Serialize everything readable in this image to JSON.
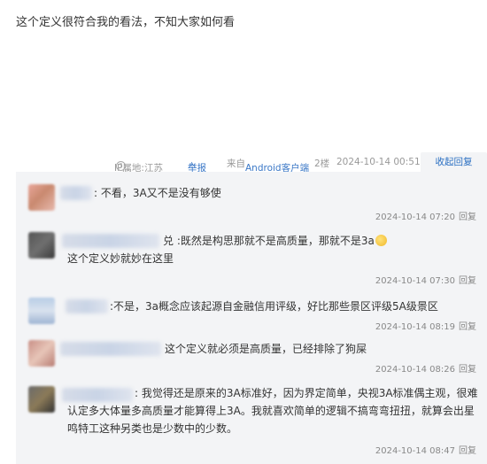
{
  "post": {
    "text": "这个定义很符合我的看法，不知大家如何看"
  },
  "meta": {
    "ip_location": "IP属地:江苏",
    "report_label": "举报",
    "source": "来自Android客户端",
    "floor": "2楼",
    "timestamp": "2024-10-14 00:51",
    "collapse_label": "收起回复"
  },
  "replies": [
    {
      "text": ": 不看，3A又不是没有够使",
      "time": "2024-10-14 07:20",
      "reply_label": "回复"
    },
    {
      "text_part1": "兑 :既然是构思那就不是高质量，那就不是3a",
      "text_part2": "这个定义妙就妙在这里",
      "time": "2024-10-14 07:30",
      "reply_label": "回复"
    },
    {
      "text": ":不是，3a概念应该起源自金融信用评级，好比那些景区评级5A级景区",
      "time": "2024-10-14 08:19",
      "reply_label": "回复"
    },
    {
      "text": "这个定义就必须是高质量，已经排除了狗屎",
      "time": "2024-10-14 08:26",
      "reply_label": "回复"
    },
    {
      "text": ": 我觉得还是原来的3A标准好，因为界定简单，央视3A标准偶主观，很难认定多大体量多高质量才能算得上3A。我就喜欢简单的逻辑不搞弯弯扭扭，就算会出星鸣特工这种另类也是少数中的少数。",
      "time": "2024-10-14 08:47",
      "reply_label": "回复"
    }
  ],
  "colors": {
    "link": "#3b78c7",
    "panel_bg": "#f3f4f6",
    "muted": "#999999"
  }
}
